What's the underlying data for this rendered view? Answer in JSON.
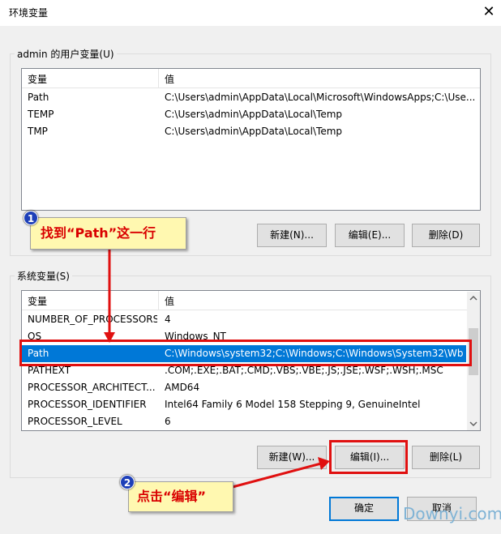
{
  "window": {
    "title": "环境变量",
    "close_glyph": "✕"
  },
  "user_vars": {
    "legend": "admin 的用户变量(U)",
    "col_var": "变量",
    "col_val": "值",
    "rows": [
      {
        "name": "Path",
        "value": "C:\\Users\\admin\\AppData\\Local\\Microsoft\\WindowsApps;C:\\Use..."
      },
      {
        "name": "TEMP",
        "value": "C:\\Users\\admin\\AppData\\Local\\Temp"
      },
      {
        "name": "TMP",
        "value": "C:\\Users\\admin\\AppData\\Local\\Temp"
      }
    ],
    "buttons": {
      "new": "新建(N)...",
      "edit": "编辑(E)...",
      "delete": "删除(D)"
    }
  },
  "sys_vars": {
    "legend": "系统变量(S)",
    "col_var": "变量",
    "col_val": "值",
    "rows": [
      {
        "name": "NUMBER_OF_PROCESSORS",
        "value": "4"
      },
      {
        "name": "OS",
        "value": "Windows_NT"
      },
      {
        "name": "Path",
        "value": "C:\\Windows\\system32;C:\\Windows;C:\\Windows\\System32\\Wb..."
      },
      {
        "name": "PATHEXT",
        "value": ".COM;.EXE;.BAT;.CMD;.VBS;.VBE;.JS;.JSE;.WSF;.WSH;.MSC"
      },
      {
        "name": "PROCESSOR_ARCHITECT...",
        "value": "AMD64"
      },
      {
        "name": "PROCESSOR_IDENTIFIER",
        "value": "Intel64 Family 6 Model 158 Stepping 9, GenuineIntel"
      },
      {
        "name": "PROCESSOR_LEVEL",
        "value": "6"
      }
    ],
    "buttons": {
      "new": "新建(W)...",
      "edit": "编辑(I)...",
      "delete": "删除(L)"
    }
  },
  "footer": {
    "ok": "确定",
    "cancel": "取消"
  },
  "annotations": {
    "step1_num": "1",
    "step1_text": "找到“Path”这一行",
    "step2_num": "2",
    "step2_text": "点击“编辑”"
  },
  "watermark": "Downyi.com",
  "colors": {
    "highlight": "#e01010",
    "selection": "#0078d7",
    "callout_bg": "#fff8b0",
    "badge": "#1d3fb8"
  }
}
